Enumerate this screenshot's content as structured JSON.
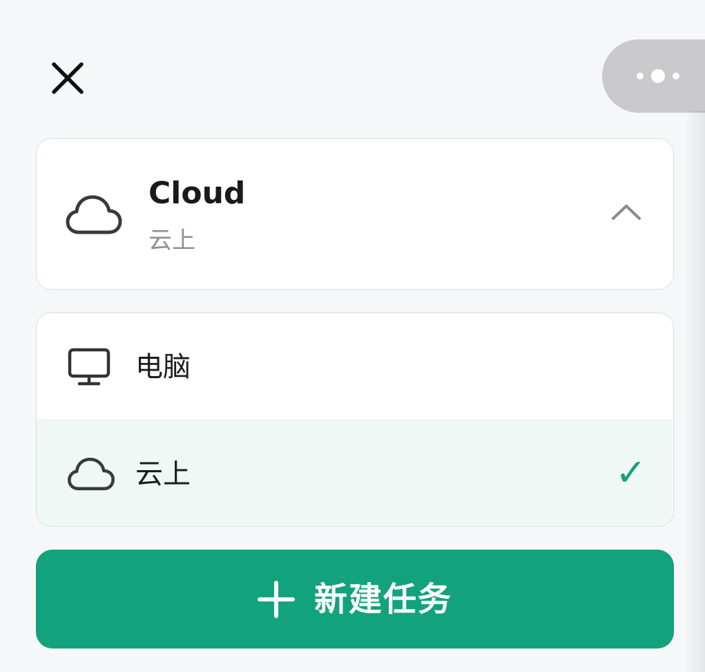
{
  "header": {
    "close_icon": "close-icon",
    "more_icon": "more-dots-icon"
  },
  "selector": {
    "icon": "cloud-icon",
    "title": "Cloud",
    "subtitle": "云上",
    "chevron_icon": "chevron-up-icon"
  },
  "options": [
    {
      "icon": "monitor-icon",
      "label": "电脑",
      "selected": false
    },
    {
      "icon": "cloud-icon",
      "label": "云上",
      "selected": true,
      "check": "✓"
    }
  ],
  "new_task_button": {
    "icon": "plus-icon",
    "label": "新建任务"
  },
  "colors": {
    "accent": "#13a37c",
    "checkmark": "#17a07a",
    "selected_row_bg": "#eff8f4",
    "page_bg": "#f6f7f9"
  }
}
